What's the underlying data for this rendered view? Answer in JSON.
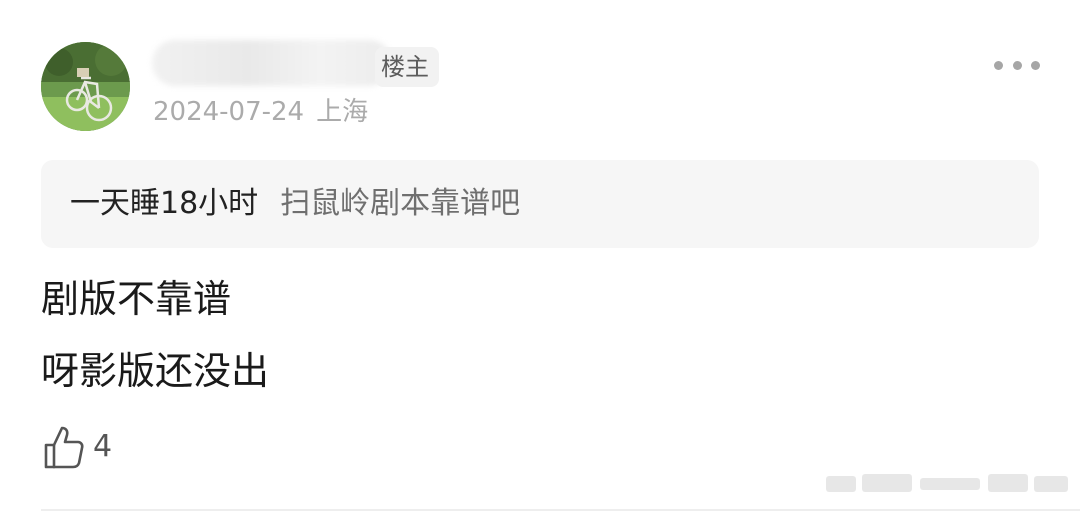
{
  "post": {
    "op_badge": "楼主",
    "date": "2024-07-24",
    "location": "上海",
    "quote": {
      "author": "一天睡18小时",
      "content": "扫鼠岭剧本靠谱吧"
    },
    "body_lines": [
      "剧版不靠谱",
      "呀影版还没出"
    ],
    "likes": "4"
  },
  "icons": {
    "more": "more-horizontal-icon",
    "like": "thumbs-up-icon"
  },
  "colors": {
    "meta_text": "#ababab",
    "quote_background": "#f6f6f6",
    "body_text": "#1a1a1a"
  }
}
